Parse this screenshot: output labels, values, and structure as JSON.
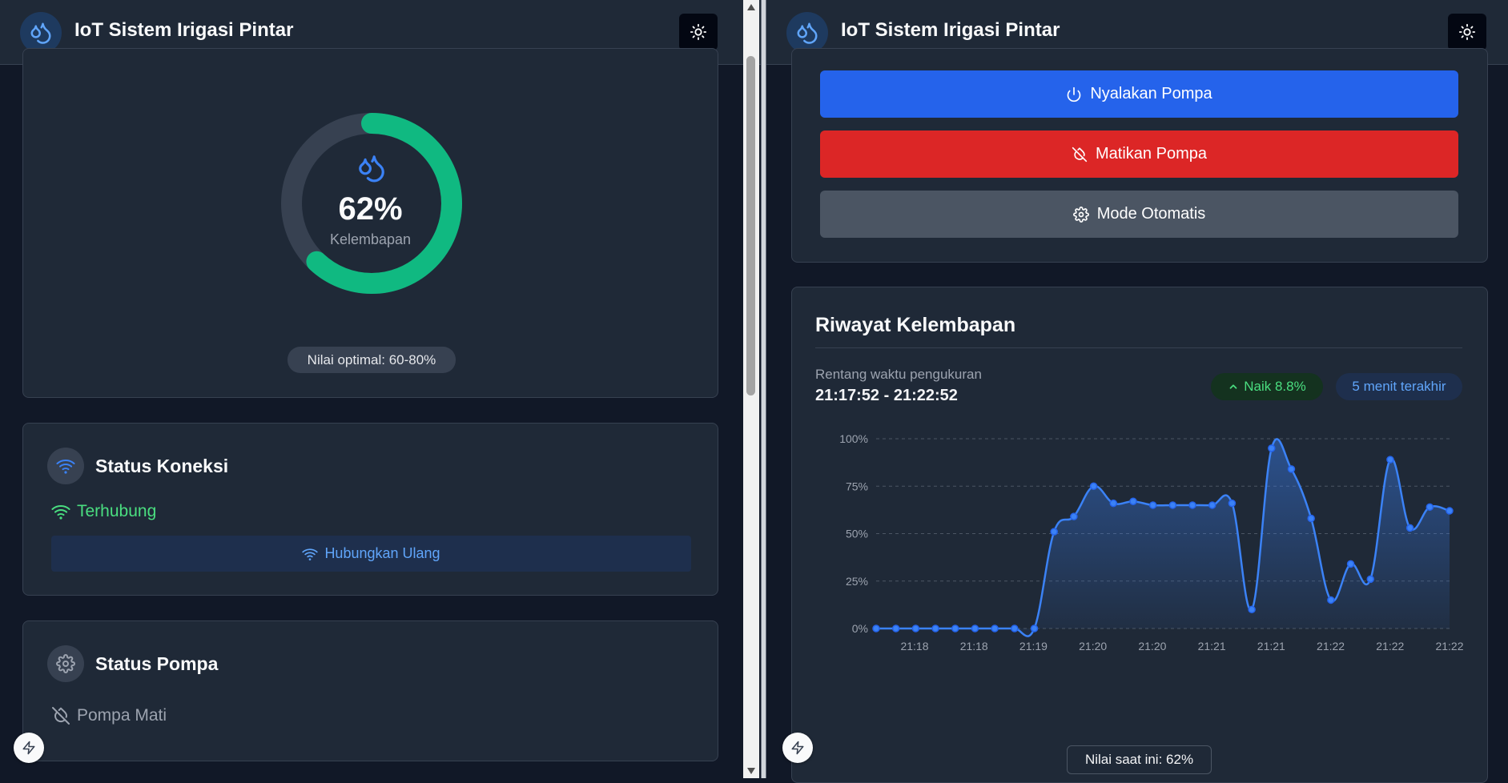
{
  "app": {
    "title": "IoT Sistem Irigasi Pintar"
  },
  "moisture_card": {
    "value_text": "62%",
    "label": "Kelembapan",
    "fraction": 0.62,
    "optimal_text": "Nilai optimal: 60-80%"
  },
  "connection_card": {
    "title": "Status Koneksi",
    "status": "Terhubung",
    "reconnect_label": "Hubungkan Ulang"
  },
  "pump_card": {
    "title": "Status Pompa",
    "status": "Pompa Mati"
  },
  "controls": {
    "on_label": "Nyalakan Pompa",
    "off_label": "Matikan Pompa",
    "auto_label": "Mode Otomatis"
  },
  "history": {
    "title": "Riwayat Kelembapan",
    "range_label": "Rentang waktu pengukuran",
    "range_value": "21:17:52 - 21:22:52",
    "trend_label": "Naik 8.8%",
    "window_label": "5 menit terakhir",
    "current_text": "Nilai saat ini: 62%"
  },
  "colors": {
    "accent_blue": "#2563eb",
    "danger_red": "#dc2626",
    "neutral_gray": "#4b5563",
    "success_green": "#10b981",
    "status_green": "#4ade80",
    "line_blue": "#3b82f6"
  },
  "icons": {
    "logo": "droplets-icon",
    "theme": "sun-icon",
    "connection": "wifi-icon",
    "pump": "gear-icon",
    "pump_off": "droplet-off-icon",
    "power": "power-icon",
    "fab": "lightning-icon"
  },
  "chart_data": {
    "type": "area",
    "title": "Riwayat Kelembapan",
    "x_tick_labels": [
      "21:18",
      "21:18",
      "21:19",
      "21:20",
      "21:20",
      "21:21",
      "21:21",
      "21:22",
      "21:22",
      "21:22"
    ],
    "y_tick_labels": [
      "0%",
      "25%",
      "50%",
      "75%",
      "100%"
    ],
    "ylim": [
      0,
      100
    ],
    "grid": true,
    "series": [
      {
        "values": [
          0,
          0,
          0,
          0,
          0,
          0,
          0,
          0,
          0,
          51,
          59,
          75,
          66,
          67,
          65,
          65,
          65,
          65,
          66,
          10,
          95,
          84,
          58,
          15,
          34,
          26,
          89,
          53,
          64,
          62
        ]
      }
    ]
  }
}
